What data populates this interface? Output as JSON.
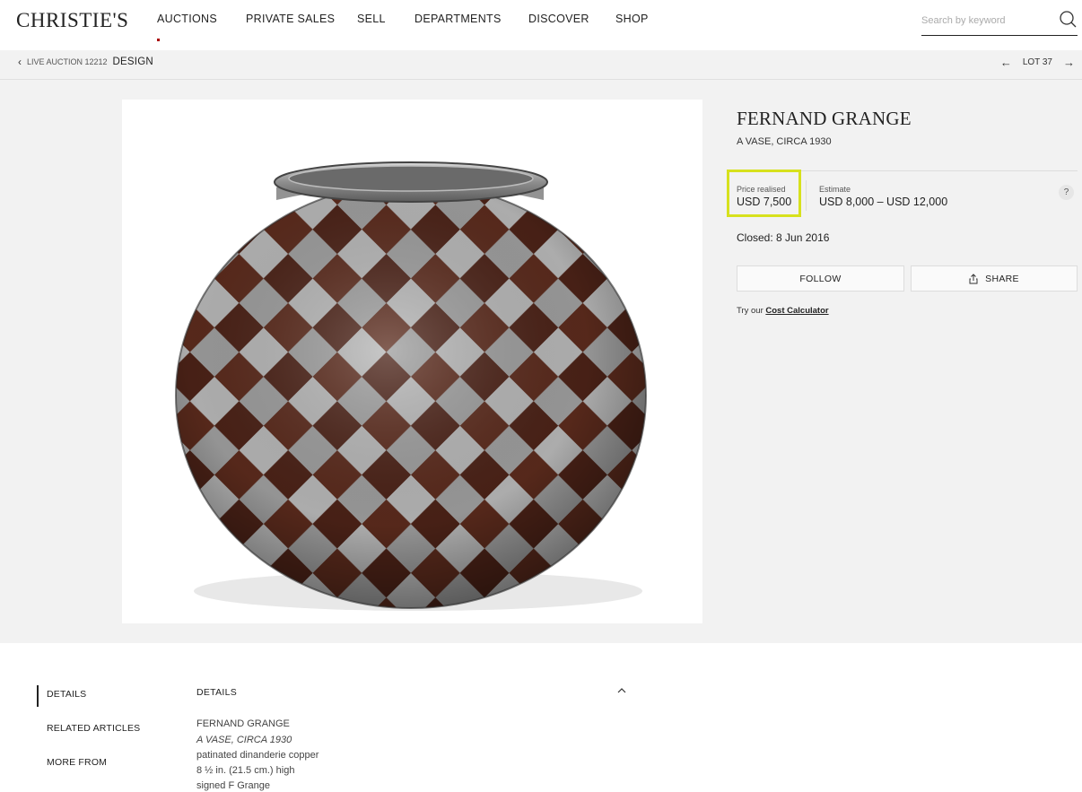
{
  "header": {
    "logo": "CHRISTIE'S",
    "nav": [
      "AUCTIONS",
      "PRIVATE SALES",
      "SELL",
      "DEPARTMENTS",
      "DISCOVER",
      "SHOP"
    ],
    "search_placeholder": "Search by keyword",
    "search_icon": "search-icon"
  },
  "breadcrumb": {
    "back_icon": "chevron-left-icon",
    "auction": "LIVE AUCTION 12212",
    "sale": "DESIGN"
  },
  "lot_nav": {
    "prev_icon": "arrow-left-icon",
    "label": "LOT 37",
    "next_icon": "arrow-right-icon"
  },
  "lot": {
    "artist": "FERNAND GRANGE",
    "title": "A VASE, CIRCA 1930",
    "price_label": "Price realised",
    "price_value": "USD 7,500",
    "estimate_label": "Estimate",
    "estimate_value": "USD 8,000 – USD 12,000",
    "help": "?",
    "closed_prefix": "Closed: ",
    "closed_date": "8 Jun 2016",
    "follow": "FOLLOW",
    "share": "SHARE",
    "cost_prefix": "Try our ",
    "cost_link": "Cost Calculator",
    "highlight_color": "#d7e11d"
  },
  "details": {
    "side_items": [
      "DETAILS",
      "RELATED ARTICLES",
      "MORE FROM"
    ],
    "heading": "DETAILS",
    "lines": [
      "FERNAND GRANGE",
      "A VASE, CIRCA 1930",
      "patinated dinanderie copper",
      "8 ½ in. (21.5 cm.) high",
      "signed F Grange"
    ]
  }
}
